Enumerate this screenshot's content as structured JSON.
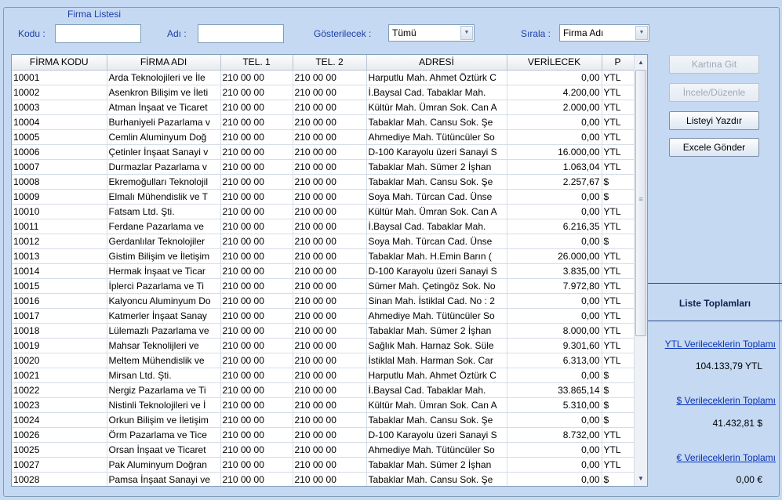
{
  "group_title": "Firma Listesi",
  "filters": {
    "kodu_label": "Kodu :",
    "kodu_value": "",
    "adi_label": "Adı :",
    "adi_value": "",
    "gosterilecek_label": "Gösterilecek :",
    "gosterilecek_value": "Tümü",
    "sirala_label": "Sırala :",
    "sirala_value": "Firma Adı"
  },
  "grid": {
    "columns": [
      "FİRMA KODU",
      "FİRMA ADI",
      "TEL. 1",
      "TEL. 2",
      "ADRESİ",
      "VERİLECEK",
      "P"
    ],
    "rows": [
      [
        "10001",
        "Arda Teknolojileri ve İle",
        "210 00 00",
        "210 00 00",
        "Harputlu Mah. Ahmet Öztürk C",
        "0,00",
        "YTL"
      ],
      [
        "10002",
        "Asenkron Bilişim ve İleti",
        "210 00 00",
        "210 00 00",
        "İ.Baysal Cad. Tabaklar Mah.",
        "4.200,00",
        "YTL"
      ],
      [
        "10003",
        "Atman İnşaat ve Ticaret",
        "210 00 00",
        "210 00 00",
        "Kültür Mah. Ümran Sok. Can A",
        "2.000,00",
        "YTL"
      ],
      [
        "10004",
        "Burhaniyeli Pazarlama v",
        "210 00 00",
        "210 00 00",
        "Tabaklar Mah. Cansu Sok. Şe",
        "0,00",
        "YTL"
      ],
      [
        "10005",
        "Cemlin Aluminyum Doğ",
        "210 00 00",
        "210 00 00",
        "Ahmediye Mah. Tütüncüler So",
        "0,00",
        "YTL"
      ],
      [
        "10006",
        "Çetinler İnşaat Sanayi v",
        "210 00 00",
        "210 00 00",
        "D-100 Karayolu üzeri Sanayi S",
        "16.000,00",
        "YTL"
      ],
      [
        "10007",
        "Durmazlar Pazarlama v",
        "210 00 00",
        "210 00 00",
        "Tabaklar Mah. Sümer 2 İşhan",
        "1.063,04",
        "YTL"
      ],
      [
        "10008",
        "Ekremoğulları Teknolojil",
        "210 00 00",
        "210 00 00",
        "Tabaklar Mah. Cansu Sok. Şe",
        "2.257,67",
        "$"
      ],
      [
        "10009",
        "Elmalı Mühendislik ve T",
        "210 00 00",
        "210 00 00",
        "Soya Mah. Türcan Cad. Ünse",
        "0,00",
        "$"
      ],
      [
        "10010",
        "Fatsam Ltd. Şti.",
        "210 00 00",
        "210 00 00",
        "Kültür Mah. Ümran Sok. Can A",
        "0,00",
        "YTL"
      ],
      [
        "10011",
        "Ferdane Pazarlama ve",
        "210 00 00",
        "210 00 00",
        "İ.Baysal Cad. Tabaklar Mah.",
        "6.216,35",
        "YTL"
      ],
      [
        "10012",
        "Gerdanlılar Teknolojiler",
        "210 00 00",
        "210 00 00",
        "Soya Mah. Türcan Cad. Ünse",
        "0,00",
        "$"
      ],
      [
        "10013",
        "Gistim Bilişim ve İletişim",
        "210 00 00",
        "210 00 00",
        "Tabaklar Mah. H.Emin Barın (",
        "26.000,00",
        "YTL"
      ],
      [
        "10014",
        "Hermak İnşaat ve Ticar",
        "210 00 00",
        "210 00 00",
        "D-100 Karayolu üzeri Sanayi S",
        "3.835,00",
        "YTL"
      ],
      [
        "10015",
        "İplerci Pazarlama ve Ti",
        "210 00 00",
        "210 00 00",
        "Sümer Mah. Çetingöz Sok. No",
        "7.972,80",
        "YTL"
      ],
      [
        "10016",
        "Kalyoncu Aluminyum Do",
        "210 00 00",
        "210 00 00",
        "Sinan Mah. İstiklal Cad. No : 2",
        "0,00",
        "YTL"
      ],
      [
        "10017",
        "Katmerler İnşaat Sanay",
        "210 00 00",
        "210 00 00",
        "Ahmediye Mah. Tütüncüler So",
        "0,00",
        "YTL"
      ],
      [
        "10018",
        "Lülemazlı Pazarlama ve",
        "210 00 00",
        "210 00 00",
        "Tabaklar Mah. Sümer 2 İşhan",
        "8.000,00",
        "YTL"
      ],
      [
        "10019",
        "Mahsar Teknolijleri ve",
        "210 00 00",
        "210 00 00",
        "Sağlık Mah. Harnaz Sok. Süle",
        "9.301,60",
        "YTL"
      ],
      [
        "10020",
        "Meltem Mühendislik ve",
        "210 00 00",
        "210 00 00",
        "İstiklal Mah. Harman Sok. Car",
        "6.313,00",
        "YTL"
      ],
      [
        "10021",
        "Mirsan Ltd. Şti.",
        "210 00 00",
        "210 00 00",
        "Harputlu Mah. Ahmet Öztürk C",
        "0,00",
        "$"
      ],
      [
        "10022",
        "Nergiz Pazarlama ve Ti",
        "210 00 00",
        "210 00 00",
        "İ.Baysal Cad. Tabaklar Mah.",
        "33.865,14",
        "$"
      ],
      [
        "10023",
        "Nistinli Teknolojileri ve İ",
        "210 00 00",
        "210 00 00",
        "Kültür Mah. Ümran Sok. Can A",
        "5.310,00",
        "$"
      ],
      [
        "10024",
        "Orkun Bilişim ve İletişim",
        "210 00 00",
        "210 00 00",
        "Tabaklar Mah. Cansu Sok. Şe",
        "0,00",
        "$"
      ],
      [
        "10026",
        "Örm Pazarlama ve Tice",
        "210 00 00",
        "210 00 00",
        "D-100 Karayolu üzeri Sanayi S",
        "8.732,00",
        "YTL"
      ],
      [
        "10025",
        "Orsan İnşaat ve Ticaret",
        "210 00 00",
        "210 00 00",
        "Ahmediye Mah. Tütüncüler So",
        "0,00",
        "YTL"
      ],
      [
        "10027",
        "Pak Aluminyum Doğran",
        "210 00 00",
        "210 00 00",
        "Tabaklar Mah. Sümer 2 İşhan",
        "0,00",
        "YTL"
      ],
      [
        "10028",
        "Pamsa İnşaat Sanayi ve",
        "210 00 00",
        "210 00 00",
        "Tabaklar Mah. Cansu Sok. Şe",
        "0,00",
        "$"
      ]
    ]
  },
  "buttons": {
    "kartina_git": "Kartına Git",
    "incele_duzenle": "İncele/Düzenle",
    "listeyi_yazdir": "Listeyi Yazdır",
    "excele_gonder": "Excele Gönder"
  },
  "totals": {
    "title": "Liste Toplamları",
    "ytl_label": "YTL Verileceklerin Toplamı",
    "ytl_value": "104.133,79 YTL",
    "usd_label": "$ Verileceklerin Toplamı",
    "usd_value": "41.432,81 $",
    "eur_label": "€ Verileceklerin Toplamı",
    "eur_value": "0,00 €"
  },
  "icons": {
    "combo_arrow": "chevron-down-icon",
    "scroll_up": "arrow-up-icon",
    "scroll_down": "arrow-down-icon"
  }
}
